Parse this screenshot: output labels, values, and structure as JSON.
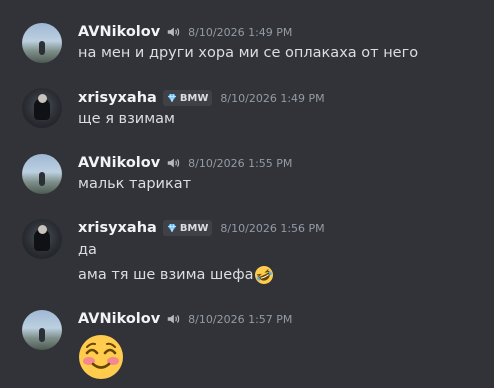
{
  "messages": [
    {
      "author": "AVNikolov",
      "time": "8/10/2026 1:49 PM",
      "lines": [
        "на мен и други хора ми се оплакаха от него"
      ]
    },
    {
      "author": "xrisyxaha",
      "badge": "BMW",
      "time": "8/10/2026 1:49 PM",
      "lines": [
        "ще я взимам"
      ]
    },
    {
      "author": "AVNikolov",
      "time": "8/10/2026 1:55 PM",
      "lines": [
        "мальк тарикат"
      ]
    },
    {
      "author": "xrisyxaha",
      "badge": "BMW",
      "time": "8/10/2026 1:56 PM",
      "lines": [
        "да",
        "ама тя ше взима шефа"
      ]
    },
    {
      "author": "AVNikolov",
      "time": "8/10/2026 1:57 PM",
      "emoji": "smiling-face-with-smiling-eyes"
    }
  ],
  "icons": {
    "speaker": "speaker-icon",
    "gem": "gem-icon",
    "rofl": "rolling-on-floor-laughing-emoji",
    "blush": "smiling-face-with-smiling-eyes-emoji"
  },
  "colors": {
    "background": "#323339",
    "name": "#f2f3f5",
    "text": "#dbdee1",
    "timestamp": "#949ba4"
  }
}
